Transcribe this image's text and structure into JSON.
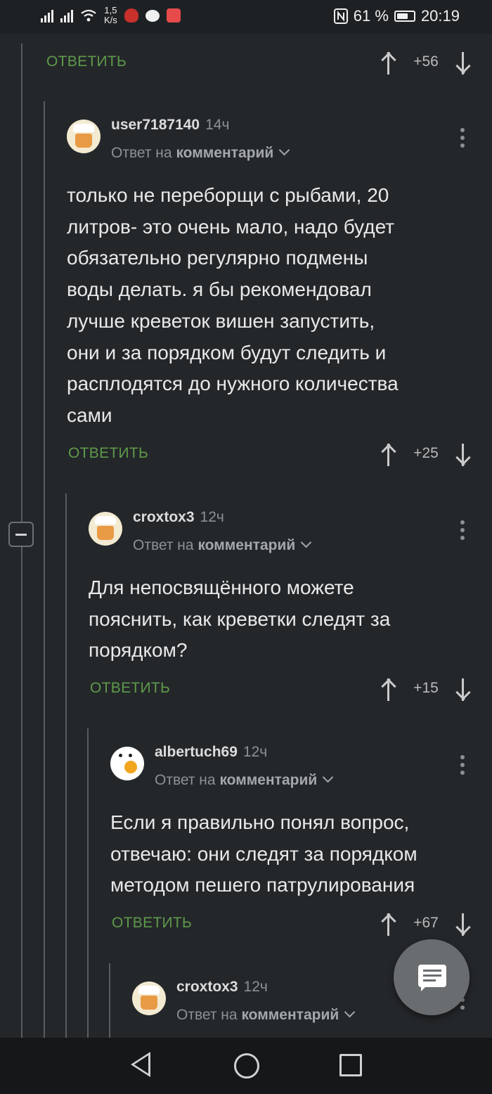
{
  "status_bar": {
    "net_speed_value": "1,5",
    "net_speed_unit": "K/s",
    "battery": "61 %",
    "time": "20:19",
    "icons": [
      "signal-icon",
      "roaming-signal-icon",
      "wifi-icon",
      "app-shield-icon",
      "chat-bubble-icon",
      "app-red-icon",
      "nfc-icon",
      "battery-icon"
    ]
  },
  "colors": {
    "background": "#24272a",
    "reply_green": "#5e9a4a",
    "text": "#e9e9e9",
    "muted": "#8e9194"
  },
  "top_controls": {
    "reply_label": "ОТВЕТИТЬ",
    "score": "+56"
  },
  "comments": [
    {
      "username": "user7187140",
      "time": "14ч",
      "reply_prefix": "Ответ на",
      "reply_target": "комментарий",
      "text": "только не переборщи с рыбами, 20\nлитров- это очень мало, надо будет\nобязательно регулярно подмены\nводы делать. я бы рекомендовал\nлучше креветок вишен запустить,\nони и за порядком будут следить и\nрасплодятся до нужного количества\nсами",
      "reply_label": "ОТВЕТИТЬ",
      "score": "+25"
    },
    {
      "username": "croxtox3",
      "time": "12ч",
      "reply_prefix": "Ответ на",
      "reply_target": "комментарий",
      "text": "Для непосвящённого можете\nпояснить, как креветки следят за\nпорядком?",
      "reply_label": "ОТВЕТИТЬ",
      "score": "+15"
    },
    {
      "username": "albertuch69",
      "time": "12ч",
      "reply_prefix": "Ответ на",
      "reply_target": "комментарий",
      "text": "Если я правильно понял вопрос,\nотвечаю: они следят за порядком\nметодом пешего патрулирования",
      "reply_label": "ОТВЕТИТЬ",
      "score": "+67"
    },
    {
      "username": "croxtox3",
      "time": "12ч",
      "reply_prefix": "Ответ на",
      "reply_target": "комментарий"
    }
  ]
}
